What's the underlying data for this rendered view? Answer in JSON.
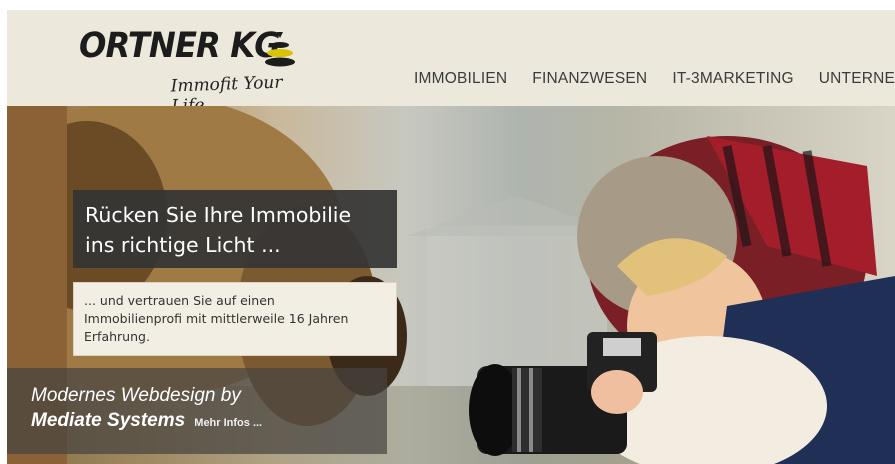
{
  "header": {
    "logo": {
      "name": "ORTNER KG",
      "tagline": "Immofit Your Life"
    },
    "nav": [
      {
        "label": "IMMOBILIEN"
      },
      {
        "label": "FINANZWESEN"
      },
      {
        "label": "IT-3MARKETING"
      },
      {
        "label": "UNTERNEH"
      }
    ]
  },
  "hero": {
    "headline_line1": "Rücken Sie Ihre Immobilie",
    "headline_line2": "ins richtige Licht ...",
    "subtext_line1": "... und vertrauen Sie auf einen",
    "subtext_line2": "Immobilienprofi mit mittlerweile 16 Jahren",
    "subtext_line3": "Erfahrung."
  },
  "credit": {
    "line1": "Modernes Webdesign by",
    "brand": "Mediate Systems",
    "more_link": "Mehr Infos ..."
  },
  "colors": {
    "header_bg": "#ece8dc",
    "headline_box": "#343434",
    "subtext_box": "#f2eee3",
    "logo_accent": "#d9c400"
  }
}
